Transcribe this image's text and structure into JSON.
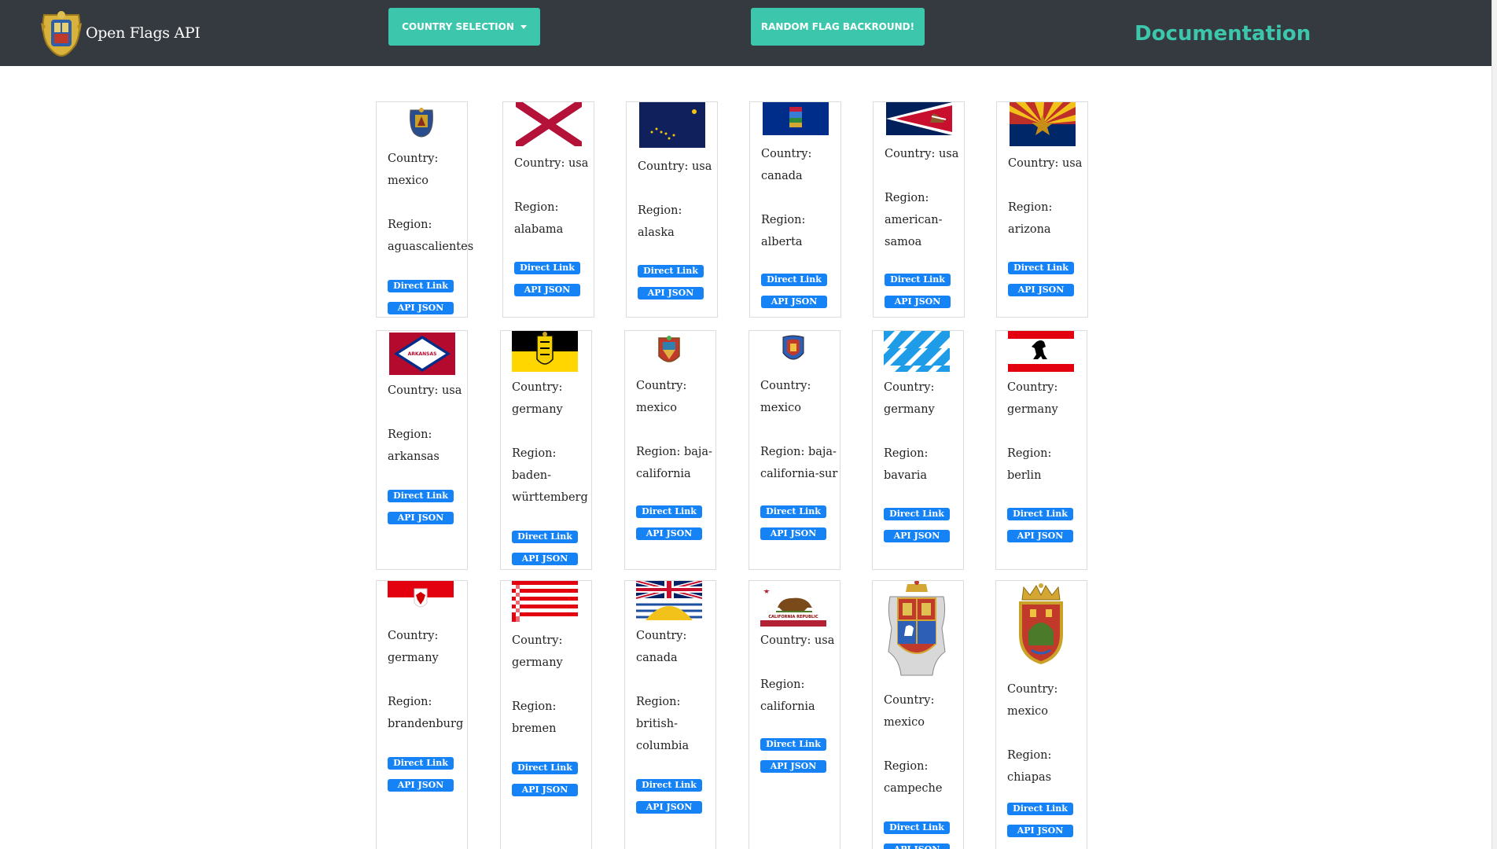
{
  "navbar": {
    "brand": "Open Flags API",
    "country_selection": "COUNTRY SELECTION",
    "random_flag": "RANDOM FLAG BACKROUND!",
    "documentation": "Documentation"
  },
  "labels": {
    "direct_link": "Direct Link",
    "api_json": "API JSON"
  },
  "cards": [
    {
      "country": "Country: mexico",
      "region": "Region: aguascalientes",
      "flag_icon": "aguascalientes-flag"
    },
    {
      "country": "Country: usa",
      "region": "Region: alabama",
      "flag_icon": "alabama-flag"
    },
    {
      "country": "Country: usa",
      "region": "Region: alaska",
      "flag_icon": "alaska-flag"
    },
    {
      "country": "Country: canada",
      "region": "Region: alberta",
      "flag_icon": "alberta-flag"
    },
    {
      "country": "Country: usa",
      "region": "Region: american-samoa",
      "flag_icon": "american-samoa-flag"
    },
    {
      "country": "Country: usa",
      "region": "Region: arizona",
      "flag_icon": "arizona-flag"
    },
    {
      "country": "Country: usa",
      "region": "Region: arkansas",
      "flag_icon": "arkansas-flag"
    },
    {
      "country": "Country: germany",
      "region": "Region: baden-württemberg",
      "flag_icon": "baden-wurttemberg-flag"
    },
    {
      "country": "Country: mexico",
      "region": "Region: baja-california",
      "flag_icon": "baja-california-flag"
    },
    {
      "country": "Country: mexico",
      "region": "Region: baja-california-sur",
      "flag_icon": "baja-california-sur-flag"
    },
    {
      "country": "Country: germany",
      "region": "Region: bavaria",
      "flag_icon": "bavaria-flag"
    },
    {
      "country": "Country: germany",
      "region": "Region: berlin",
      "flag_icon": "berlin-flag"
    },
    {
      "country": "Country: germany",
      "region": "Region: brandenburg",
      "flag_icon": "brandenburg-flag"
    },
    {
      "country": "Country: germany",
      "region": "Region: bremen",
      "flag_icon": "bremen-flag"
    },
    {
      "country": "Country: canada",
      "region": "Region: british-columbia",
      "flag_icon": "british-columbia-flag"
    },
    {
      "country": "Country: usa",
      "region": "Region: california",
      "flag_icon": "california-flag"
    },
    {
      "country": "Country: mexico",
      "region": "Region: campeche",
      "flag_icon": "campeche-flag"
    },
    {
      "country": "Country: mexico",
      "region": "Region: chiapas",
      "flag_icon": "chiapas-flag"
    }
  ],
  "colors": {
    "navbar_bg": "#343a40",
    "accent": "#3cc7ad",
    "badge": "#1582f5"
  }
}
